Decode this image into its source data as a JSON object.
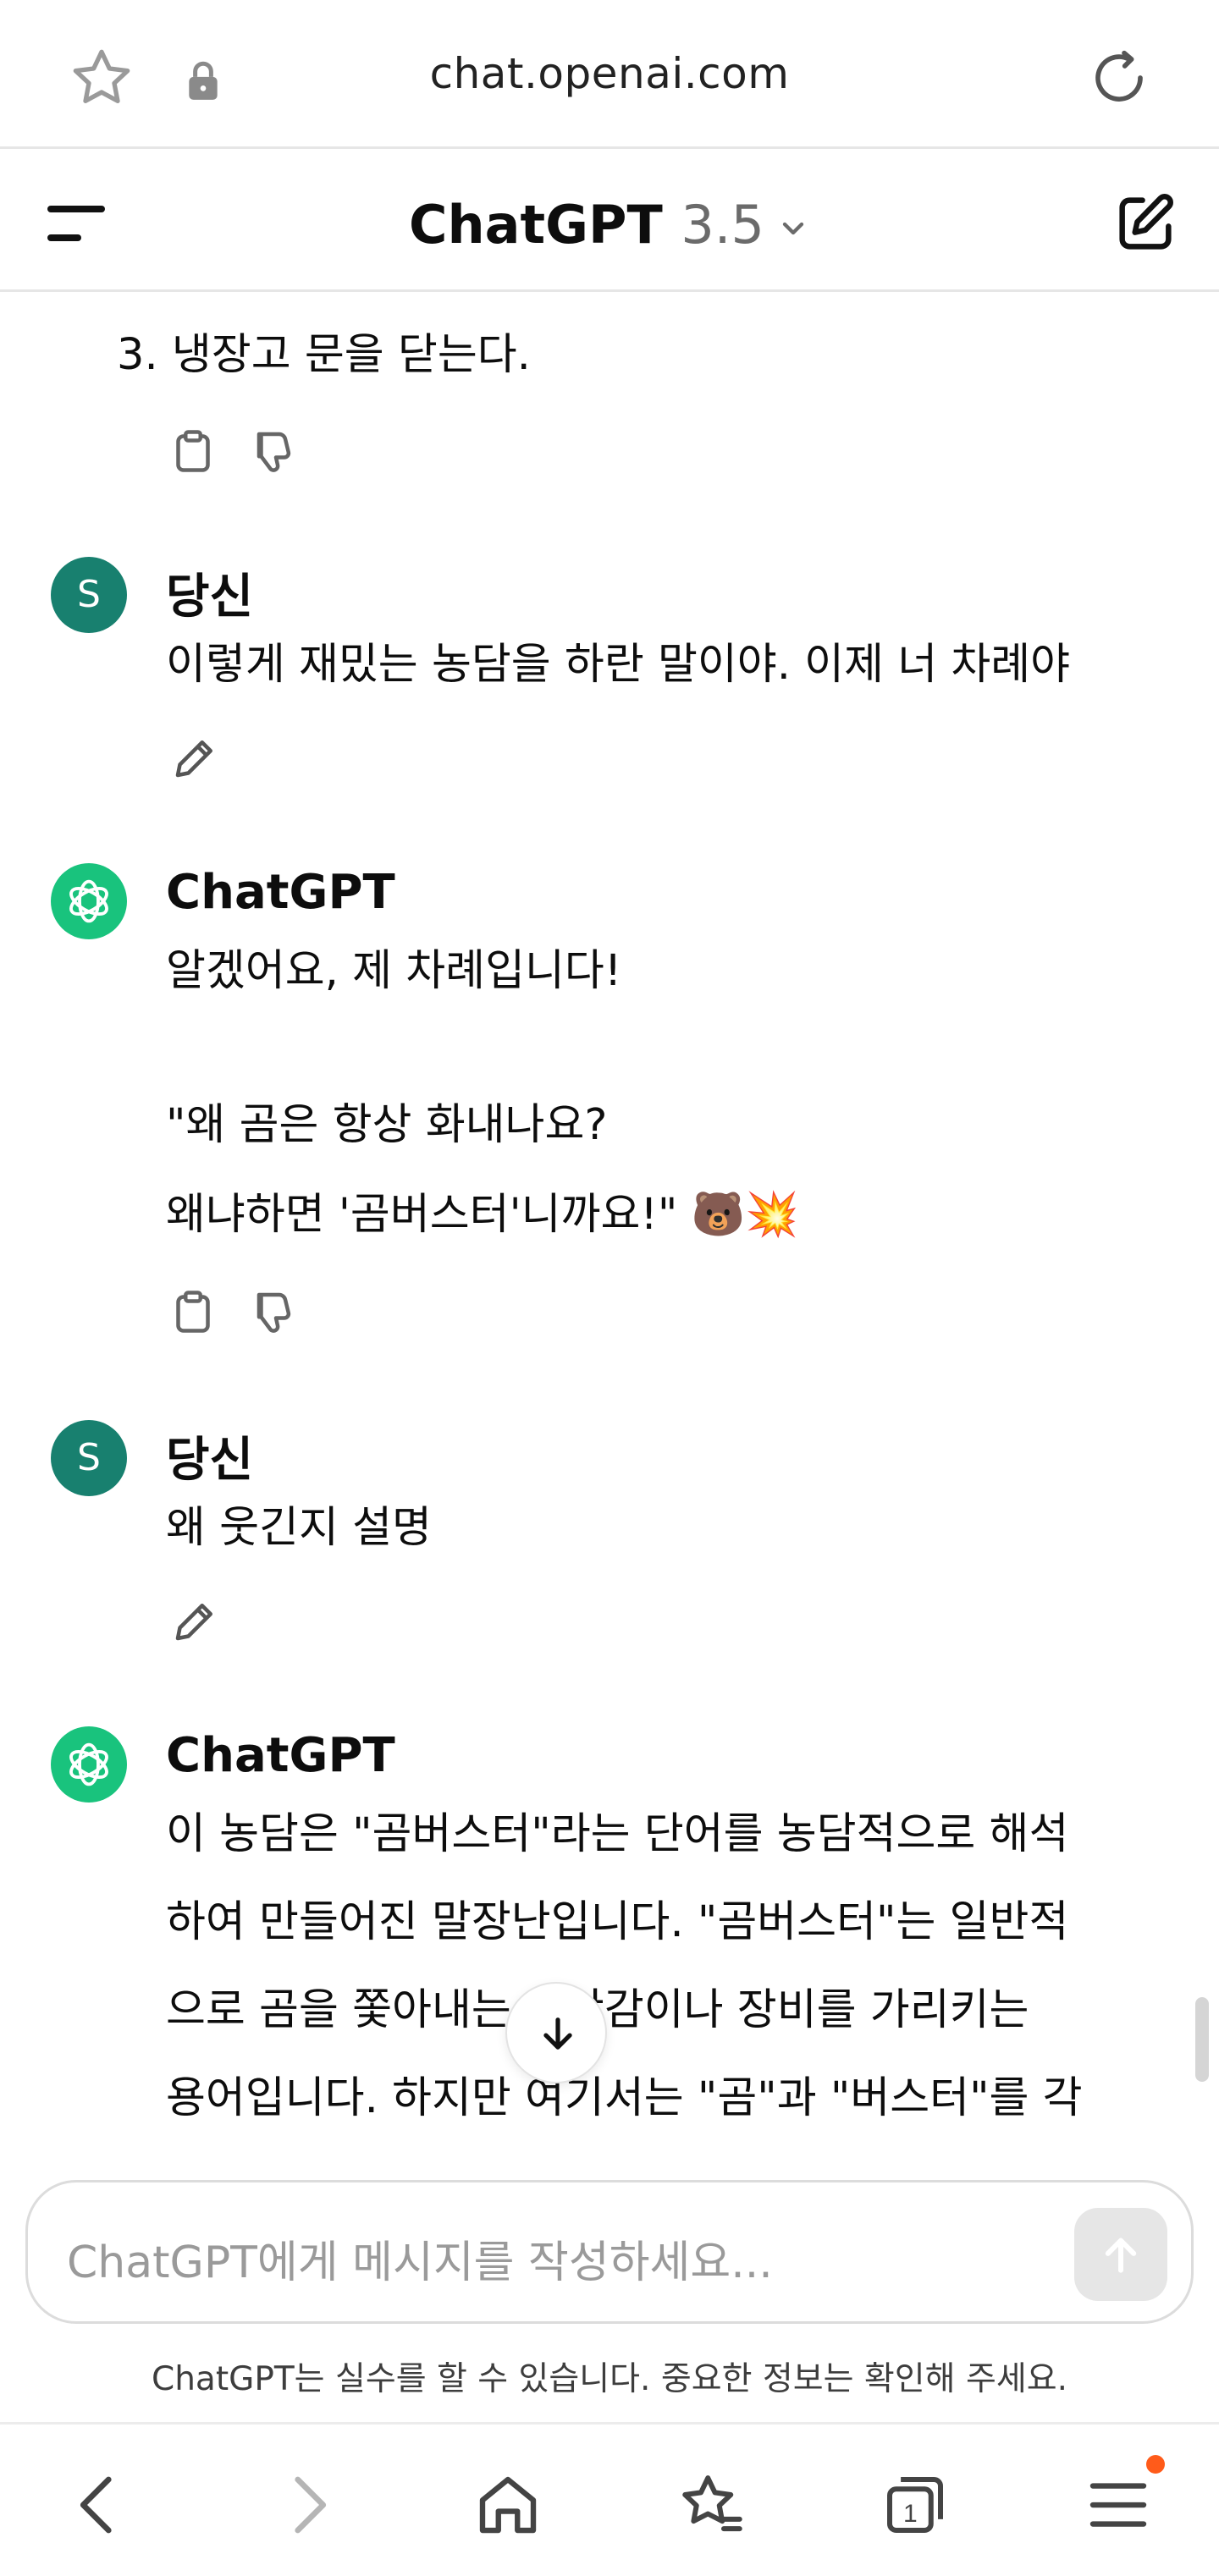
{
  "browser": {
    "url": "chat.openai.com"
  },
  "header": {
    "title": "ChatGPT",
    "version": "3.5"
  },
  "messages": [
    {
      "role": "assistant_tail",
      "lines": [
        "3.  냉장고 문을 닫는다."
      ]
    },
    {
      "role": "user",
      "avatar_letter": "S",
      "author": "당신",
      "lines": [
        "이렇게 재밌는 농담을 하란 말이야. 이제 너 차례야"
      ]
    },
    {
      "role": "assistant",
      "author": "ChatGPT",
      "lines": [
        "알겠어요, 제 차례입니다!",
        "\"왜 곰은 항상 화내나요?",
        "왜냐하면 '곰버스터'니까요!\" 🐻💥"
      ]
    },
    {
      "role": "user",
      "avatar_letter": "S",
      "author": "당신",
      "lines": [
        "왜 웃긴지 설명"
      ]
    },
    {
      "role": "assistant",
      "author": "ChatGPT",
      "lines": [
        "이 농담은 \"곰버스터\"라는 단어를 농담적으로 해석",
        "하여 만들어진 말장난입니다. \"곰버스터\"는 일반적",
        "으로 곰을 쫓아내는 장난감이나 장비를 가리키는",
        "용어입니다. 하지만 여기서는 \"곰\"과 \"버스터\"를 각"
      ]
    }
  ],
  "composer": {
    "placeholder": "ChatGPT에게 메시지를 작성하세요..."
  },
  "disclaimer": "ChatGPT는 실수를 할 수 있습니다. 중요한 정보는 확인해 주세요.",
  "colors": {
    "user_avatar": "#18806f",
    "assistant_avatar": "#19c37d",
    "notification_dot": "#ff5b1a"
  },
  "icons": {
    "bookmark": "star-icon",
    "secure": "lock-icon",
    "reload": "reload-icon",
    "menu": "hamburger-menu-icon",
    "model_switch": "chevron-down-icon",
    "new_chat": "compose-icon",
    "copy": "clipboard-icon",
    "dislike": "thumbs-down-icon",
    "edit": "pencil-icon",
    "scroll_down": "arrow-down-icon",
    "send": "arrow-up-icon",
    "nav_back": "chevron-left-icon",
    "nav_forward": "chevron-right-icon",
    "nav_home": "home-icon",
    "nav_bookmarks": "bookmarks-star-icon",
    "nav_tabs": "tabs-icon",
    "nav_menu": "menu-icon"
  },
  "browser_nav": {
    "tab_count": "1"
  }
}
